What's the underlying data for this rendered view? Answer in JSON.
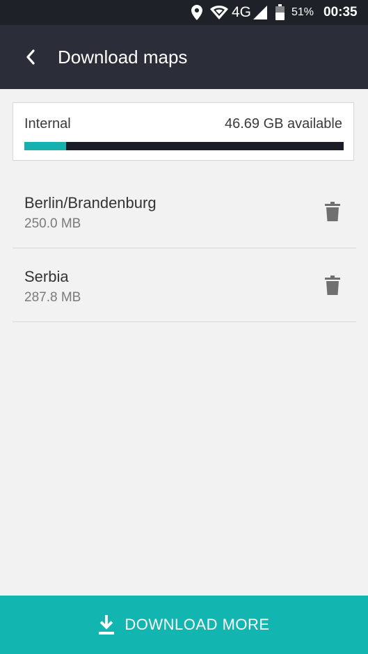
{
  "status_bar": {
    "network": "4G",
    "battery": "51%",
    "time": "00:35",
    "icons": [
      "location-icon",
      "wifi-icon",
      "signal-icon",
      "battery-icon"
    ]
  },
  "app_bar": {
    "title": "Download maps",
    "back_icon": "chevron-left-icon"
  },
  "storage": {
    "label": "Internal",
    "available": "46.69 GB available",
    "used_fraction": 0.13,
    "fill_color": "#16b0ae",
    "track_color": "#1a1c26"
  },
  "maps": [
    {
      "name": "Berlin/Brandenburg",
      "size": "250.0 MB",
      "action_icon": "trash-icon"
    },
    {
      "name": "Serbia",
      "size": "287.8 MB",
      "action_icon": "trash-icon"
    }
  ],
  "footer": {
    "download_label": "DOWNLOAD MORE",
    "icon": "download-icon",
    "color": "#13b5b0"
  }
}
